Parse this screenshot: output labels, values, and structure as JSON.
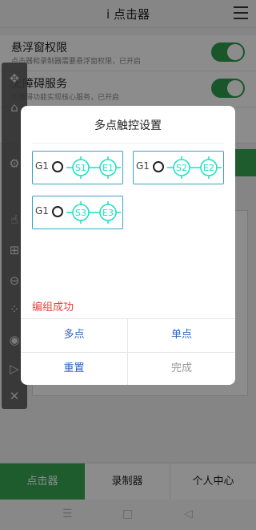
{
  "header": {
    "title": "i 点击器"
  },
  "settings": [
    {
      "title": "悬浮窗权限",
      "desc": "点击器和录制器需要悬浮窗权限，已开启"
    },
    {
      "title": "无障碍服务",
      "desc": "无障碍功能实现核心服务，已开启"
    }
  ],
  "dialog": {
    "title": "多点触控设置",
    "groups": [
      {
        "label": "G1",
        "start": "S1",
        "end": "E1"
      },
      {
        "label": "G1",
        "start": "S2",
        "end": "E2"
      },
      {
        "label": "G1",
        "start": "S3",
        "end": "E3"
      }
    ],
    "message": "编组成功",
    "buttons": {
      "multi": "多点",
      "single": "单点",
      "reset": "重置",
      "done": "完成"
    }
  },
  "bottom_nav": {
    "clicker": "点击器",
    "recorder": "录制器",
    "profile": "个人中心"
  },
  "colors": {
    "accent": "#37a855",
    "group_border": "#3aa0c8",
    "marker": "#19e0c0",
    "success": "#e0463c",
    "button_text": "#2f63c6"
  }
}
